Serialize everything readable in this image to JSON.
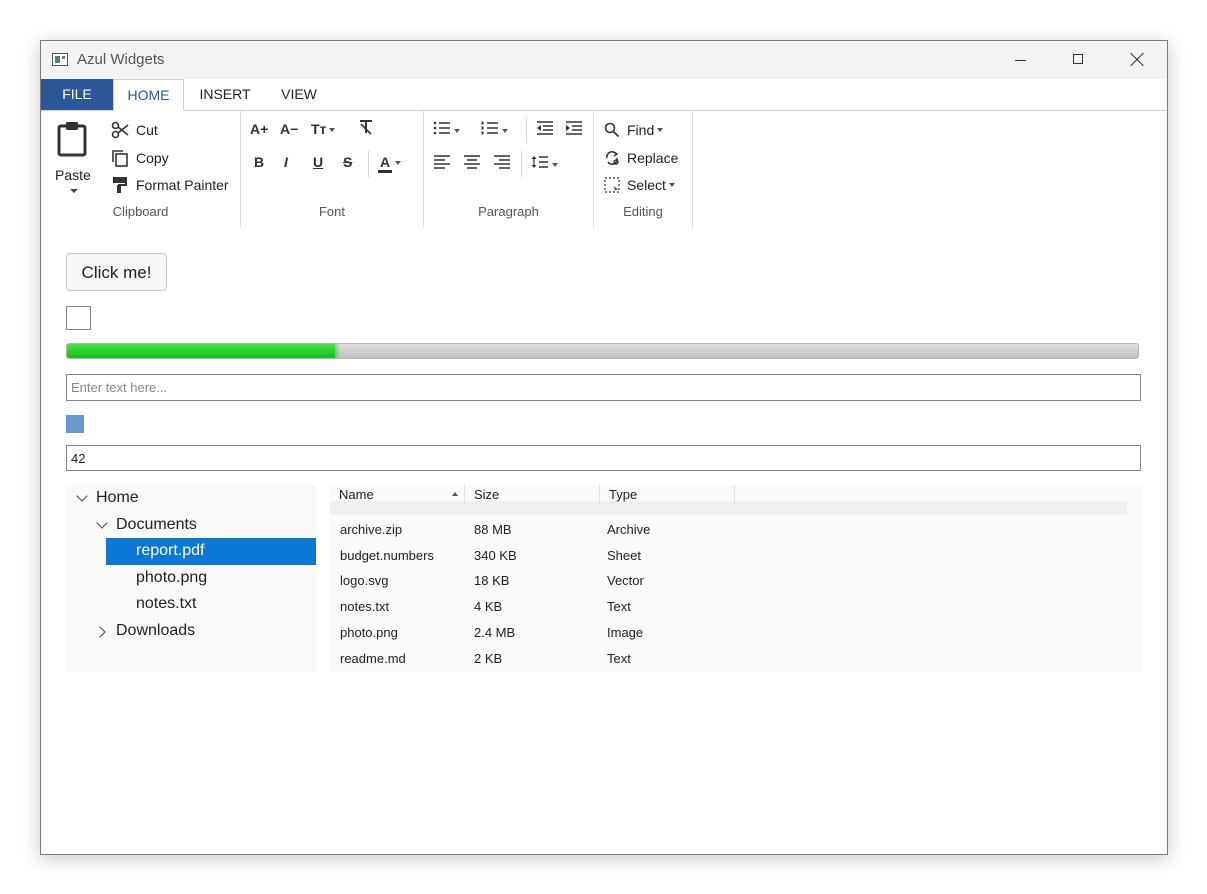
{
  "window": {
    "title": "Azul Widgets"
  },
  "tabs": [
    {
      "label": "FILE"
    },
    {
      "label": "HOME"
    },
    {
      "label": "INSERT"
    },
    {
      "label": "VIEW"
    }
  ],
  "ribbon": {
    "clipboard": {
      "label": "Clipboard",
      "paste": "Paste",
      "cut": "Cut",
      "copy": "Copy",
      "format_painter": "Format Painter"
    },
    "font": {
      "label": "Font",
      "grow": "A+",
      "shrink": "A−",
      "case": "Tт",
      "bold": "B",
      "italic": "I",
      "underline": "U",
      "strike": "S",
      "color_a": "A"
    },
    "paragraph": {
      "label": "Paragraph"
    },
    "editing": {
      "label": "Editing",
      "find": "Find",
      "replace": "Replace",
      "select": "Select"
    }
  },
  "content": {
    "button_label": "Click me!",
    "checkbox_checked": false,
    "progress_percent": 25,
    "text_placeholder": "Enter text here...",
    "swatch_color": "#6699cc",
    "number_value": "42"
  },
  "tree": {
    "home": "Home",
    "documents": "Documents",
    "files": [
      "report.pdf",
      "photo.png",
      "notes.txt"
    ],
    "downloads": "Downloads",
    "selected": "report.pdf"
  },
  "list": {
    "columns": [
      "Name",
      "Size",
      "Type"
    ],
    "rows": [
      {
        "name": "archive.zip",
        "size": "88 MB",
        "type": "Archive"
      },
      {
        "name": "budget.numbers",
        "size": "340 KB",
        "type": "Sheet"
      },
      {
        "name": "logo.svg",
        "size": "18 KB",
        "type": "Vector"
      },
      {
        "name": "notes.txt",
        "size": "4 KB",
        "type": "Text"
      },
      {
        "name": "photo.png",
        "size": "2.4 MB",
        "type": "Image"
      },
      {
        "name": "readme.md",
        "size": "2 KB",
        "type": "Text"
      }
    ]
  },
  "colors": {
    "accent": "#2b579a",
    "selection": "#0b78d6",
    "progress": "#22cc22"
  }
}
